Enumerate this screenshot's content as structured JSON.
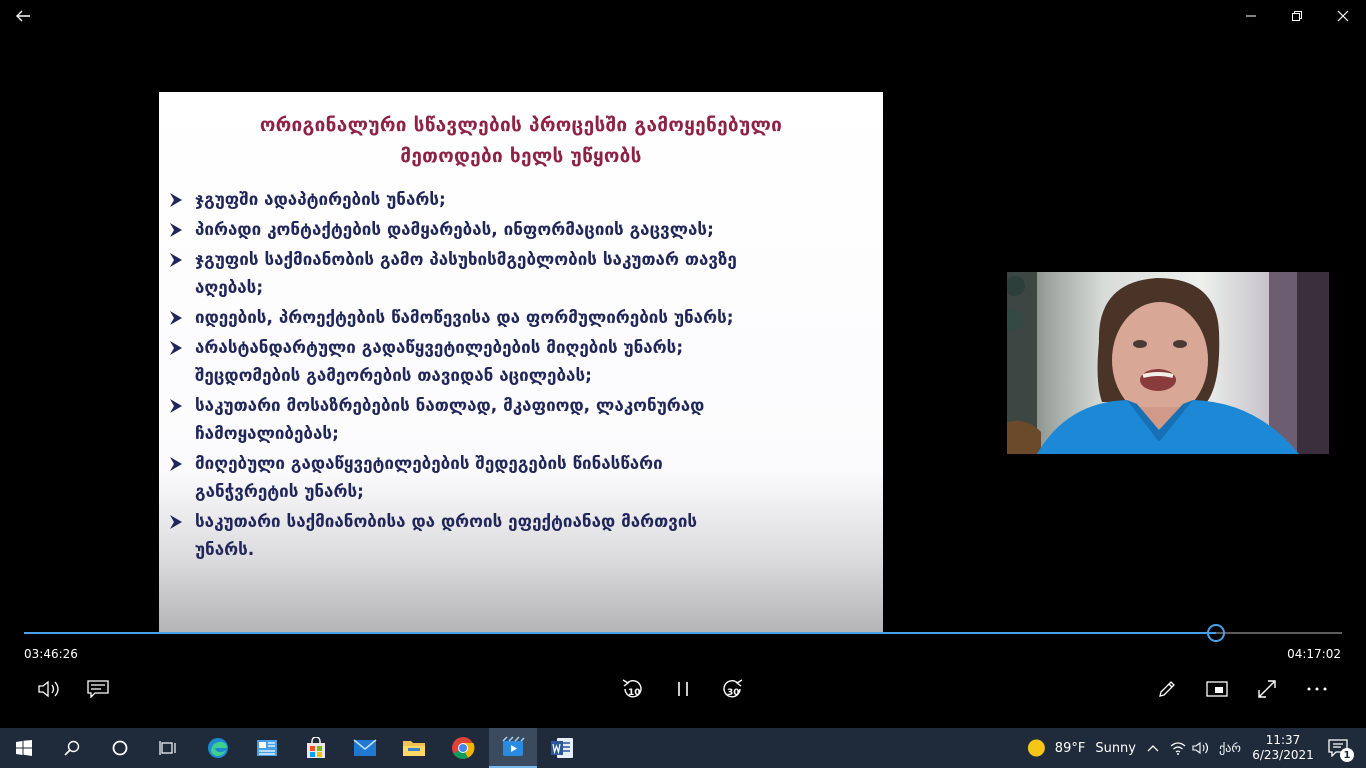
{
  "slide": {
    "title_line1": "ორიგინალური სწავლების პროცესში გამოყენებული",
    "title_line2": "მეთოდები ხელს უწყობს",
    "bullets": [
      {
        "line1": "ჯგუფში ადაპტირების უნარს;",
        "line2": ""
      },
      {
        "line1": "პირადი კონტაქტების დამყარებას, ინფორმაციის გაცვლას;",
        "line2": ""
      },
      {
        "line1": "ჯგუფის საქმიანობის გამო პასუხისმგებლობის საკუთარ თავზე",
        "line2": "აღებას;"
      },
      {
        "line1": "იდეების, პროექტების წამოწევისა და ფორმულირების უნარს;",
        "line2": ""
      },
      {
        "line1": "არასტანდარტული გადაწყვეტილებების მიღების უნარს;",
        "line2": "შეცდომების გამეორების თავიდან აცილებას;"
      },
      {
        "line1": "საკუთარი მოსაზრებების ნათლად, მკაფიოდ, ლაკონურად",
        "line2": "ჩამოყალიბებას;"
      },
      {
        "line1": "მიღებული გადაწყვეტილებების შედეგების წინასწარი",
        "line2": "განჭვრეტის უნარს;"
      },
      {
        "line1": "საკუთარი საქმიანობისა და დროის ეფექტიანად მართვის",
        "line2": "უნარს."
      }
    ]
  },
  "player": {
    "current_time": "03:46:26",
    "total_time": "04:17:02",
    "progress_fraction": 0.9045,
    "skip_back_label": "10",
    "skip_forward_label": "30"
  },
  "taskbar": {
    "weather_temp": "89°F",
    "weather_condition": "Sunny",
    "language": "ქარ",
    "time": "11:37",
    "date": "6/23/2021",
    "notification_count": "1"
  },
  "icons": [
    "back-arrow-icon",
    "minimize-icon",
    "maximize-icon",
    "close-icon",
    "volume-icon",
    "subtitles-icon",
    "skip-back-icon",
    "pause-icon",
    "skip-forward-icon",
    "pen-icon",
    "mini-view-icon",
    "fullscreen-icon",
    "more-icon",
    "windows-start-icon",
    "search-icon",
    "cortana-icon",
    "task-view-icon",
    "edge-icon",
    "photos-icon",
    "store-icon",
    "mail-icon",
    "file-explorer-icon",
    "chrome-icon",
    "movies-tv-icon",
    "word-icon",
    "sun-icon",
    "chevron-up-icon",
    "wifi-icon",
    "speaker-icon",
    "notification-icon"
  ],
  "colors": {
    "accent": "#4aa0e6",
    "title": "#8e2245",
    "bullet_text": "#21265a",
    "taskbar": "#1f2b3a"
  }
}
